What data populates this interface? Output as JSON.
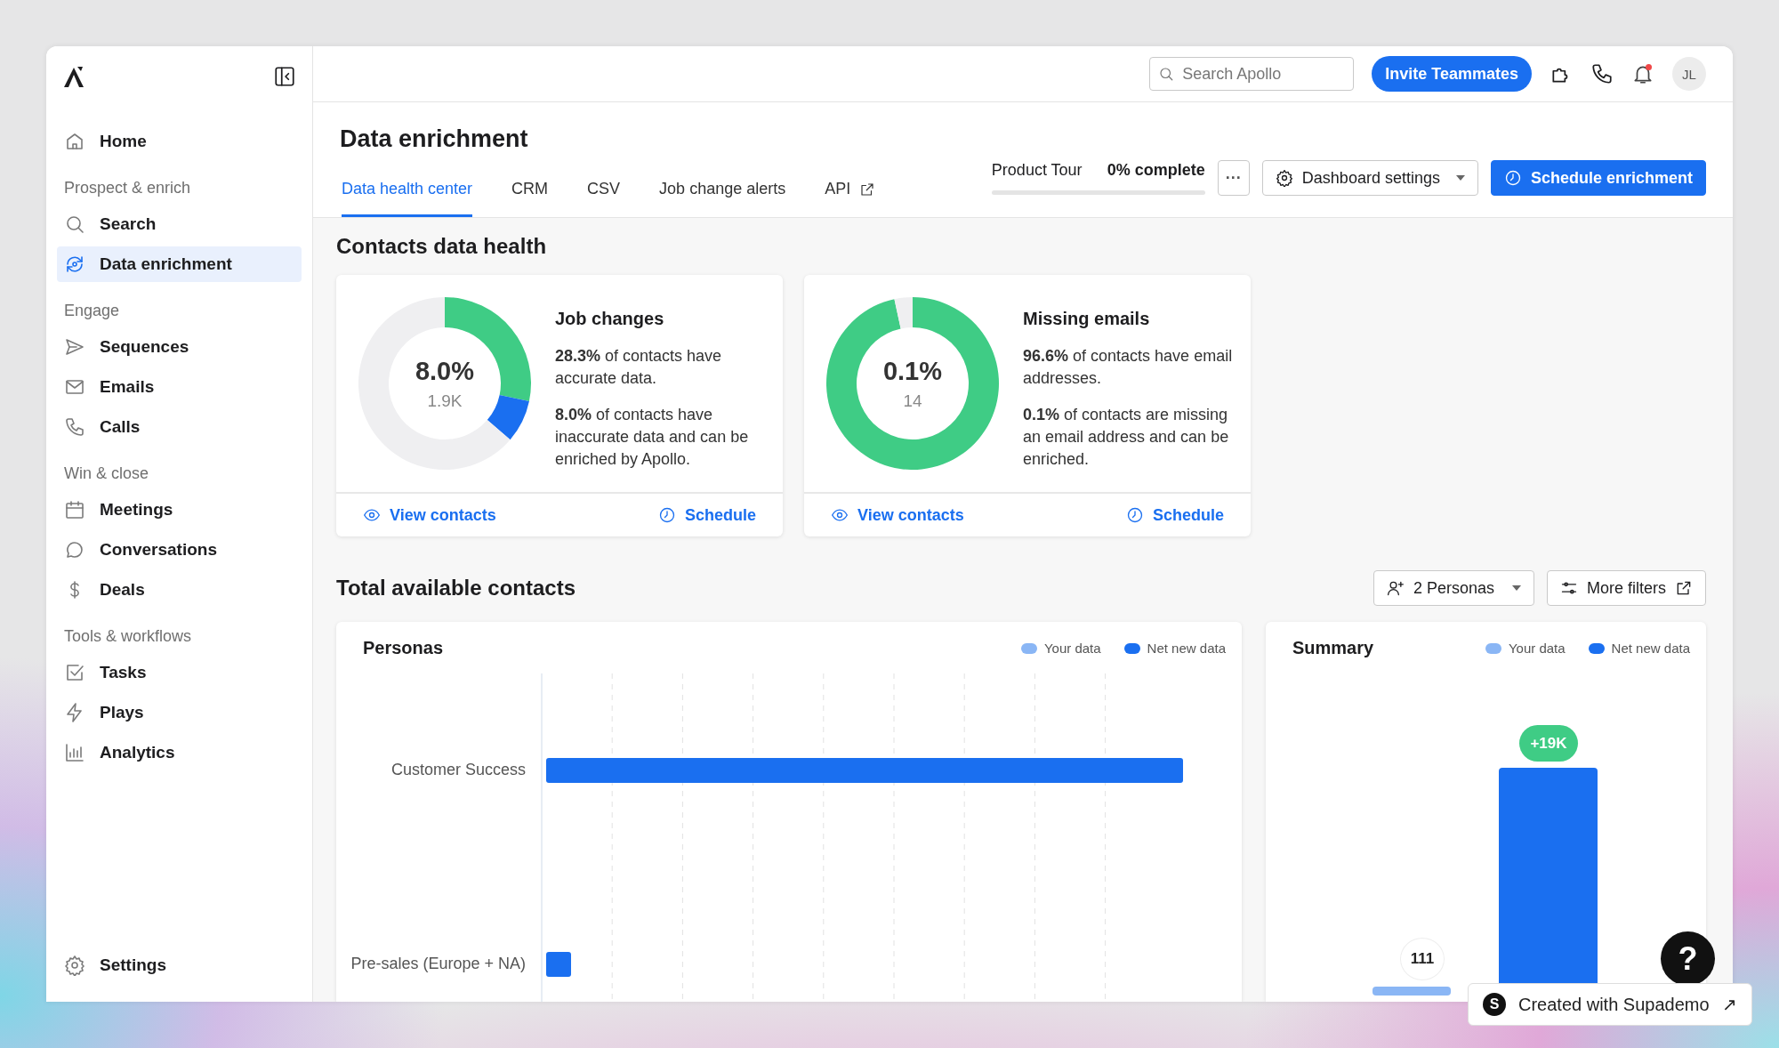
{
  "sidebar": {
    "groups": [
      {
        "items": [
          {
            "label": "Home",
            "selected": false
          }
        ]
      },
      {
        "heading": "Prospect & enrich",
        "items": [
          {
            "label": "Search",
            "selected": false
          },
          {
            "label": "Data enrichment",
            "selected": true
          }
        ]
      },
      {
        "heading": "Engage",
        "items": [
          {
            "label": "Sequences",
            "selected": false
          },
          {
            "label": "Emails",
            "selected": false
          },
          {
            "label": "Calls",
            "selected": false
          }
        ]
      },
      {
        "heading": "Win & close",
        "items": [
          {
            "label": "Meetings",
            "selected": false
          },
          {
            "label": "Conversations",
            "selected": false
          },
          {
            "label": "Deals",
            "selected": false
          }
        ]
      },
      {
        "heading": "Tools & workflows",
        "items": [
          {
            "label": "Tasks",
            "selected": false
          },
          {
            "label": "Plays",
            "selected": false
          },
          {
            "label": "Analytics",
            "selected": false
          }
        ]
      }
    ],
    "footer": {
      "label": "Settings",
      "selected": false
    }
  },
  "topbar": {
    "search": {
      "placeholder": "Search Apollo"
    },
    "invite": "Invite Teammates",
    "notification_dot": true,
    "avatar": "JL"
  },
  "header": {
    "title": "Data enrichment",
    "tabs": [
      {
        "label": "Data health center",
        "selected": true
      },
      {
        "label": "CRM",
        "selected": false
      },
      {
        "label": "CSV",
        "selected": false
      },
      {
        "label": "Job change alerts",
        "selected": false
      },
      {
        "label": "API",
        "selected": false,
        "external": true
      }
    ],
    "tour": {
      "label": "Product Tour",
      "status": "0% complete",
      "level": 0
    },
    "more": "···",
    "dashboard_settings": "Dashboard settings",
    "schedule": "Schedule enrichment"
  },
  "health": {
    "title": "Contacts data health",
    "cards": [
      {
        "title": "Job changes",
        "value": "8.0%",
        "count": "1.9K",
        "chart_data": {
          "type": "donut",
          "values": [
            28.3,
            8.0,
            63.7
          ],
          "colors": [
            "#3fcc85",
            "#1a6ff0",
            "#efeff1"
          ]
        },
        "paragraphs": [
          "**28.3%** of contacts have accurate data.",
          "**8.0%** of contacts have inaccurate data and can be enriched by Apollo."
        ],
        "view": "View contacts",
        "schedule": "Schedule"
      },
      {
        "title": "Missing emails",
        "value": "0.1%",
        "count": "14",
        "chart_data": {
          "type": "donut",
          "values": [
            96.6,
            3.4
          ],
          "colors": [
            "#3fcc85",
            "#efeff1"
          ]
        },
        "paragraphs": [
          "**96.6%** of contacts have email addresses.",
          "**0.1%** of contacts are missing an email address and can be enriched."
        ],
        "view": "View contacts",
        "schedule": "Schedule"
      }
    ]
  },
  "contacts": {
    "title": "Total available contacts",
    "personas_filter": "2 Personas",
    "more_filters": "More filters",
    "personas": {
      "title": "Personas",
      "legend": [
        {
          "label": "Your data",
          "color": "#8ab6f5"
        },
        {
          "label": "Net new data",
          "color": "#1a6ff0"
        }
      ],
      "categories": [
        "Customer Success",
        "Pre-sales (Europe + NA)"
      ]
    },
    "summary": {
      "title": "Summary",
      "legend": [
        {
          "label": "Your data",
          "color": "#8ab6f5"
        },
        {
          "label": "Net new data",
          "color": "#1a6ff0"
        }
      ],
      "bars": [
        {
          "label": "111"
        },
        {
          "label": "+19K"
        }
      ]
    }
  },
  "help": "?",
  "badge": {
    "logo": "S",
    "label": "Created with Supademo",
    "arrow": "↗"
  }
}
